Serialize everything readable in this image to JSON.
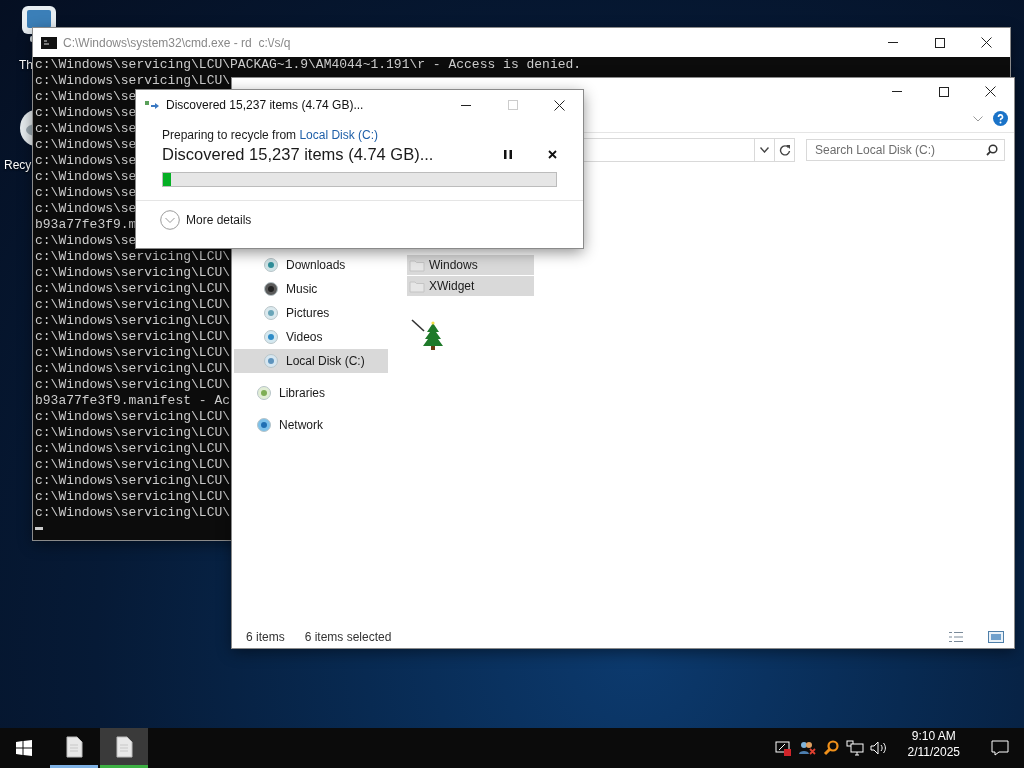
{
  "desktop_icons": [
    {
      "label": "Th"
    },
    {
      "label": "Recy"
    }
  ],
  "console": {
    "title": "C:\\Windows\\system32\\cmd.exe - rd  c:\\/s/q",
    "lines": [
      "c:\\Windows\\servicing\\LCU\\PACKAG~1.9\\AM4044~1.191\\r - Access is denied.",
      "c:\\Windows\\servicing\\LCU\\",
      "c:\\Windows\\se",
      "c:\\Windows\\se",
      "c:\\Windows\\se",
      "c:\\Windows\\se",
      "c:\\Windows\\se",
      "c:\\Windows\\se",
      "c:\\Windows\\se",
      "c:\\Windows\\se",
      "b93a77fe3f9.m",
      "c:\\Windows\\se",
      "c:\\Windows\\servicing\\LCU\\",
      "c:\\Windows\\servicing\\LCU\\",
      "c:\\Windows\\servicing\\LCU\\",
      "c:\\Windows\\servicing\\LCU\\",
      "c:\\Windows\\servicing\\LCU\\",
      "c:\\Windows\\servicing\\LCU\\",
      "c:\\Windows\\servicing\\LCU\\",
      "c:\\Windows\\servicing\\LCU\\",
      "c:\\Windows\\servicing\\LCU\\",
      "b93a77fe3f9.manifest - Ac",
      "c:\\Windows\\servicing\\LCU\\",
      "c:\\Windows\\servicing\\LCU\\",
      "c:\\Windows\\servicing\\LCU\\",
      "c:\\Windows\\servicing\\LCU\\",
      "c:\\Windows\\servicing\\LCU\\",
      "c:\\Windows\\servicing\\LCU\\",
      "c:\\Windows\\servicing\\LCU\\"
    ]
  },
  "explorer": {
    "search": {
      "placeholder": "Search Local Disk (C:)"
    },
    "nav": [
      {
        "children": [
          {
            "label": "Downloads",
            "kind": "download",
            "selected": false
          },
          {
            "label": "Music",
            "kind": "music",
            "selected": false
          },
          {
            "label": "Pictures",
            "kind": "picture",
            "selected": false
          },
          {
            "label": "Videos",
            "kind": "video",
            "selected": false
          },
          {
            "label": "Local Disk (C:)",
            "kind": "disk",
            "selected": true
          }
        ]
      },
      {
        "label": "Libraries",
        "kind": "library",
        "selected": false
      },
      {
        "label": "Network",
        "kind": "network",
        "selected": false
      }
    ],
    "files": [
      {
        "name": "Windows",
        "selected": true
      },
      {
        "name": "XWidget",
        "selected": true
      }
    ],
    "status": {
      "count": "6 items",
      "selection": "6 items selected"
    }
  },
  "dialog": {
    "title": "Discovered 15,237 items (4.74 GB)...",
    "prefix": "Preparing to recycle from ",
    "link": "Local Disk (C:)",
    "heading": "Discovered 15,237 items (4.74 GB)...",
    "progress": {
      "level": 0.02
    },
    "more": "More details"
  },
  "taskbar": {
    "apps": [
      {
        "selected": false,
        "color": "#7fb2e5"
      },
      {
        "selected": true,
        "color": "#3cb043"
      }
    ],
    "clock": {
      "time": "9:10 AM",
      "date": "2/11/2025"
    }
  }
}
